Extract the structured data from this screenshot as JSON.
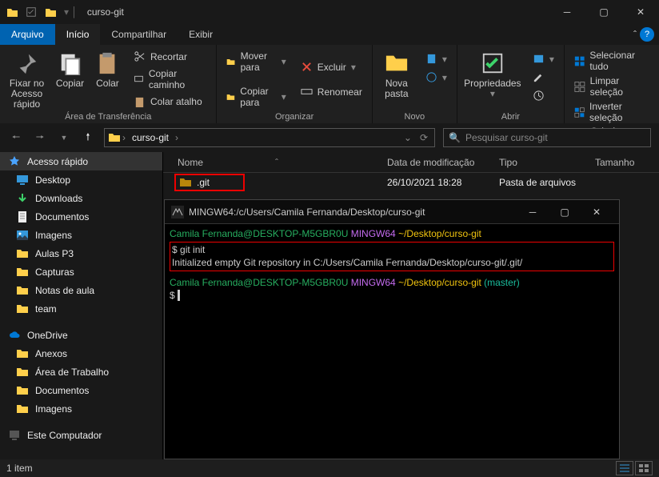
{
  "window": {
    "title": "curso-git"
  },
  "tabs": {
    "arquivo": "Arquivo",
    "inicio": "Início",
    "compartilhar": "Compartilhar",
    "exibir": "Exibir"
  },
  "ribbon": {
    "pin": "Fixar no\nAcesso rápido",
    "copiar": "Copiar",
    "colar": "Colar",
    "recortar": "Recortar",
    "copiar_caminho": "Copiar caminho",
    "colar_atalho": "Colar atalho",
    "grp_clip": "Área de Transferência",
    "mover": "Mover para",
    "copiar_para": "Copiar para",
    "excluir": "Excluir",
    "renomear": "Renomear",
    "grp_org": "Organizar",
    "nova_pasta": "Nova\npasta",
    "grp_novo": "Novo",
    "propriedades": "Propriedades",
    "grp_abrir": "Abrir",
    "sel_tudo": "Selecionar tudo",
    "limpar_sel": "Limpar seleção",
    "inv_sel": "Inverter seleção",
    "grp_sel": "Selecionar"
  },
  "breadcrumb": {
    "folder": "curso-git"
  },
  "search": {
    "placeholder": "Pesquisar curso-git"
  },
  "sidebar": {
    "quick": "Acesso rápido",
    "desktop": "Desktop",
    "downloads": "Downloads",
    "documentos": "Documentos",
    "imagens": "Imagens",
    "aulas": "Aulas P3",
    "capturas": "Capturas",
    "notas": "Notas de aula",
    "team": "team",
    "onedrive": "OneDrive",
    "anexos": "Anexos",
    "area": "Área de Trabalho",
    "documentos2": "Documentos",
    "imagens2": "Imagens",
    "este": "Este Computador"
  },
  "columns": {
    "nome": "Nome",
    "data": "Data de modificação",
    "tipo": "Tipo",
    "tam": "Tamanho"
  },
  "files": [
    {
      "name": ".git",
      "date": "26/10/2021 18:28",
      "type": "Pasta de arquivos"
    }
  ],
  "terminal": {
    "title": "MINGW64:/c/Users/Camila Fernanda/Desktop/curso-git",
    "user": "Camila Fernanda@DESKTOP-M5GBR0U",
    "shell": "MINGW64",
    "path": "~/Desktop/curso-git",
    "branch": "(master)",
    "cmd": "git init",
    "out": "Initialized empty Git repository in C:/Users/Camila Fernanda/Desktop/curso-git/.git/",
    "prompt": "$"
  },
  "status": {
    "items": "1 item"
  }
}
